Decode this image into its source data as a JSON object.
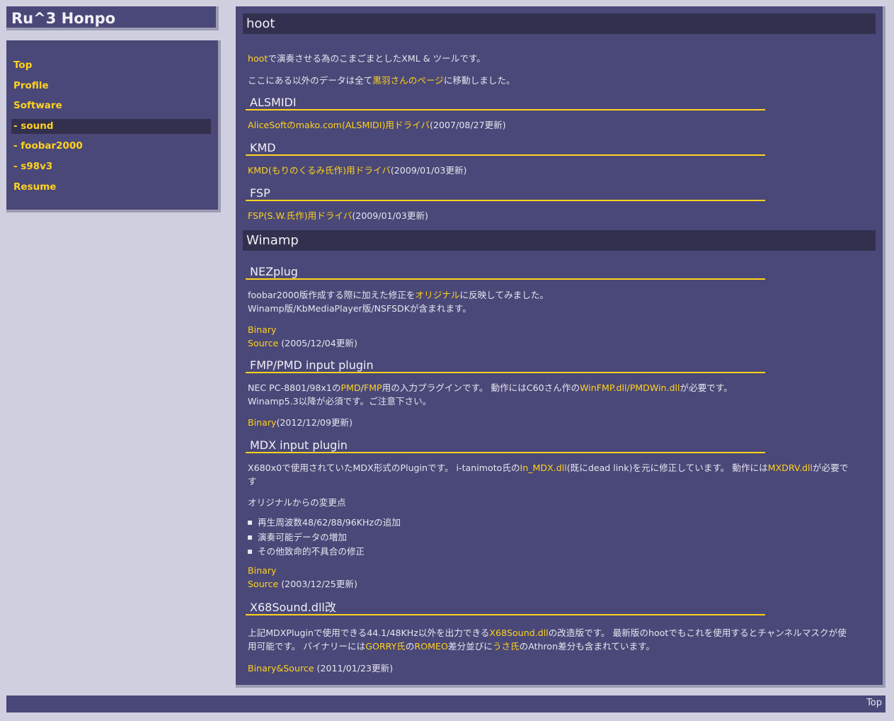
{
  "site": {
    "title": "Ru^3 Honpo"
  },
  "sidebar": {
    "items": [
      {
        "label": "Top"
      },
      {
        "label": "Profile"
      },
      {
        "label": "Software"
      },
      {
        "label": "- sound"
      },
      {
        "label": "- foobar2000"
      },
      {
        "label": "- s98v3"
      },
      {
        "label": "Resume"
      }
    ]
  },
  "hoot": {
    "heading": "hoot",
    "intro_link": "hoot",
    "intro_text": "で演奏させる為のこまごまとしたXML & ツールです。",
    "moved_pre": "ここにある以外のデータは全て",
    "moved_link": "黒羽さんのページ",
    "moved_post": "に移動しました。",
    "alsmidi": {
      "heading": "ALSMIDI",
      "link": "AliceSoftのmako.com(ALSMIDI)用ドライバ",
      "date": "(2007/08/27更新)"
    },
    "kmd": {
      "heading": "KMD",
      "link": "KMD(もりのくるみ氏作)用ドライバ",
      "date": "(2009/01/03更新)"
    },
    "fsp": {
      "heading": "FSP",
      "link": "FSP(S.W.氏作)用ドライバ",
      "date": "(2009/01/03更新)"
    }
  },
  "winamp": {
    "heading": "Winamp",
    "nezplug": {
      "heading": "NEZplug",
      "line1_pre": "foobar2000版作成する際に加えた修正を",
      "line1_link": "オリジナル",
      "line1_post": "に反映してみました。",
      "line2": "Winamp版/KbMediaPlayer版/NSFSDKが含まれます。",
      "binary": "Binary",
      "source": "Source",
      "date": " (2005/12/04更新)"
    },
    "fmp": {
      "heading": "FMP/PMD input plugin",
      "t1": "NEC PC-8801/98x1の",
      "l1": "PMD",
      "t2": "/",
      "l2": "FMP",
      "t3": "用の入力プラグインです。 動作にはC60さん作の",
      "l3": "WinFMP.dll/PMDWin.dll",
      "t4": "が必要です。",
      "line2": "Winamp5.3以降が必須です。ご注意下さい。",
      "binary": "Binary",
      "date": "(2012/12/09更新)"
    },
    "mdx": {
      "heading": "MDX input plugin",
      "t1": "X680x0で使用されていたMDX形式のPluginです。 i-tanimoto氏の",
      "l1": "In_MDX.dll",
      "t2": "(既にdead link)を元に修正しています。 動作には",
      "l2": "MXDRV.dll",
      "t3": "が必要で",
      "t4": "す",
      "changes_title": "オリジナルからの変更点",
      "changes": [
        "再生周波数48/62/88/96KHzの追加",
        "演奏可能データの増加",
        "その他致命的不具合の修正"
      ],
      "binary": "Binary",
      "source": "Source",
      "date": " (2003/12/25更新)"
    },
    "x68": {
      "heading": "X68Sound.dll改",
      "t1": "上記MDXPluginで使用できる44.1/48KHz以外を出力できる",
      "l1": "X68Sound.dll",
      "t2": "の改造版です。 最新版のhootでもこれを使用するとチャンネルマスクが使",
      "t3": "用可能です。 バイナリーには",
      "l2": "GORRY氏",
      "t4": "の",
      "l3": "ROMEO",
      "t5": "差分並びに",
      "l4": "うさ氏",
      "t6": "のAthron差分も含まれています。",
      "link": "Binary&Source",
      "date": " (2011/01/23更新)"
    }
  },
  "footer": {
    "top_label": "Top"
  }
}
